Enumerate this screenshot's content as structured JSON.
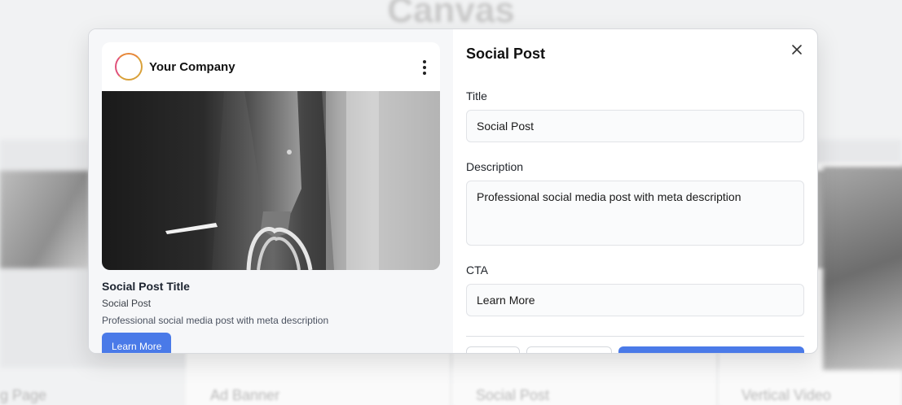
{
  "backdrop": {
    "heading": "Canvas",
    "card_labels": [
      "g Page",
      "Ad Banner",
      "Social Post",
      "Vertical Video"
    ]
  },
  "preview": {
    "company_name": "Your Company",
    "post_title": "Social Post Title",
    "post_subtitle": "Social Post",
    "post_description": "Professional social media post with meta description",
    "cta_label": "Learn More"
  },
  "form": {
    "title": "Social Post",
    "fields": {
      "title": {
        "label": "Title",
        "value": "Social Post"
      },
      "description": {
        "label": "Description",
        "value": "Professional social media post with meta description"
      },
      "cta": {
        "label": "CTA",
        "value": "Learn More"
      }
    }
  },
  "icons": {
    "close": "close-icon",
    "more": "more-vertical-icon"
  },
  "colors": {
    "accent": "#4a7ae8",
    "avatar_ring": "#e7883a"
  }
}
